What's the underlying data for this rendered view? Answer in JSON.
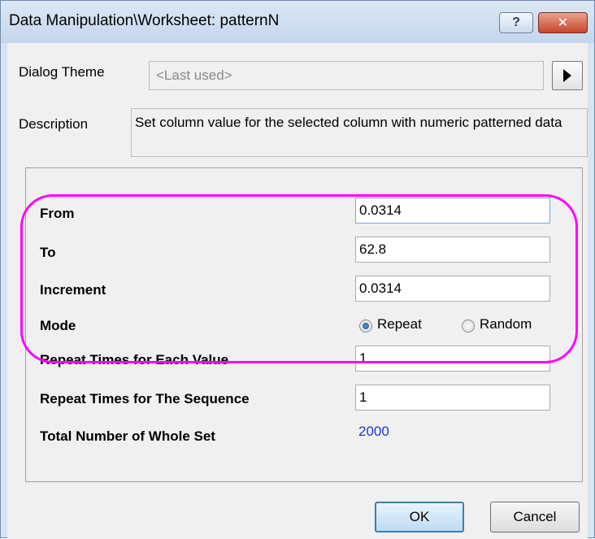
{
  "window": {
    "title": "Data Manipulation\\Worksheet: patternN",
    "help_label": "?",
    "close_label": "✕"
  },
  "theme": {
    "label": "Dialog Theme",
    "value": "<Last used>"
  },
  "description": {
    "label": "Description",
    "text": "Set column value for the selected column with numeric patterned data"
  },
  "params": {
    "from": {
      "label": "From",
      "value": "0.0314"
    },
    "to": {
      "label": "To",
      "value": "62.8"
    },
    "increment": {
      "label": "Increment",
      "value": "0.0314"
    },
    "mode": {
      "label": "Mode",
      "options": [
        "Repeat",
        "Random"
      ],
      "selected": "Repeat"
    },
    "repeat_each": {
      "label": "Repeat Times for Each Value",
      "value": "1"
    },
    "repeat_sequence": {
      "label": "Repeat Times for The Sequence",
      "value": "1"
    },
    "total": {
      "label": "Total Number of Whole Set",
      "value": "2000"
    }
  },
  "buttons": {
    "ok": "OK",
    "cancel": "Cancel"
  },
  "colors": {
    "highlight": "#ff00ff",
    "total_value": "#1f39c8"
  }
}
